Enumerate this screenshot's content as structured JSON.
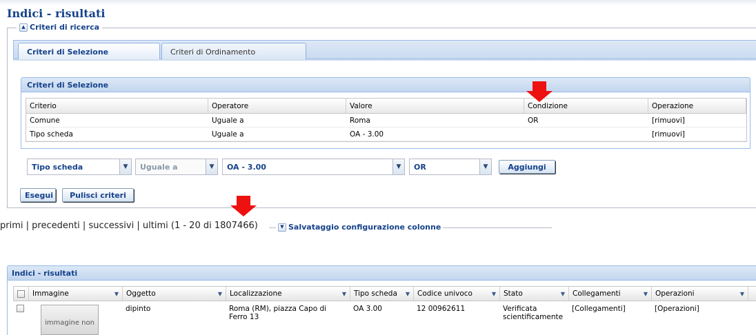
{
  "page": {
    "title": "Indici - risultati"
  },
  "search_criteria": {
    "legend": "Criteri di ricerca",
    "tabs": [
      {
        "label": "Criteri di Selezione",
        "active": true
      },
      {
        "label": "Criteri di Ordinamento",
        "active": false
      }
    ],
    "selection_panel": {
      "title": "Criteri di Selezione",
      "columns": [
        "Criterio",
        "Operatore",
        "Valore",
        "Condizione",
        "Operazione"
      ],
      "rows": [
        {
          "criterio": "Comune",
          "operatore": "Uguale a",
          "valore": "Roma",
          "condizione": "OR",
          "operazione": "[rimuovi]"
        },
        {
          "criterio": "Tipo scheda",
          "operatore": "Uguale a",
          "valore": "OA - 3.00",
          "condizione": "",
          "operazione": "[rimuovi]"
        }
      ]
    },
    "controls": {
      "field_select": "Tipo scheda",
      "operator_select": "Uguale a",
      "value_select": "OA - 3.00",
      "condition_select": "OR",
      "add_button": "Aggiungi"
    },
    "execute_button": "Esegui",
    "clear_button": "Pulisci criteri"
  },
  "pager": {
    "first": "primi",
    "previous": "precedenti",
    "next": "successivi",
    "last": "ultimi",
    "range": "(1 - 20 di 1807466)",
    "save_config": "Salvataggio configurazione colonne"
  },
  "results": {
    "title": "Indici - risultati",
    "columns": [
      "Immagine",
      "Oggetto",
      "Localizzazione",
      "Tipo scheda",
      "Codice univoco",
      "Stato",
      "Collegamenti",
      "Operazioni"
    ],
    "rows": [
      {
        "image_placeholder": "immagine non",
        "oggetto": "dipinto",
        "localizzazione": "Roma (RM), piazza Capo di Ferro 13",
        "tipo_scheda": "OA 3.00",
        "codice_univoco": "12 00962611",
        "stato": "Verificata scientificamente",
        "collegamenti": "[Collegamenti]",
        "operazioni": "[Operazioni]"
      }
    ]
  },
  "colors": {
    "accent": "#15428b",
    "arrow": "#ee1111",
    "border": "#99bbe8"
  },
  "icons": {
    "collapse": "chevron-up-icon",
    "expand": "chevron-down-icon",
    "dropdown": "dropdown-arrow-icon",
    "annotation": "red-arrow-icon"
  }
}
